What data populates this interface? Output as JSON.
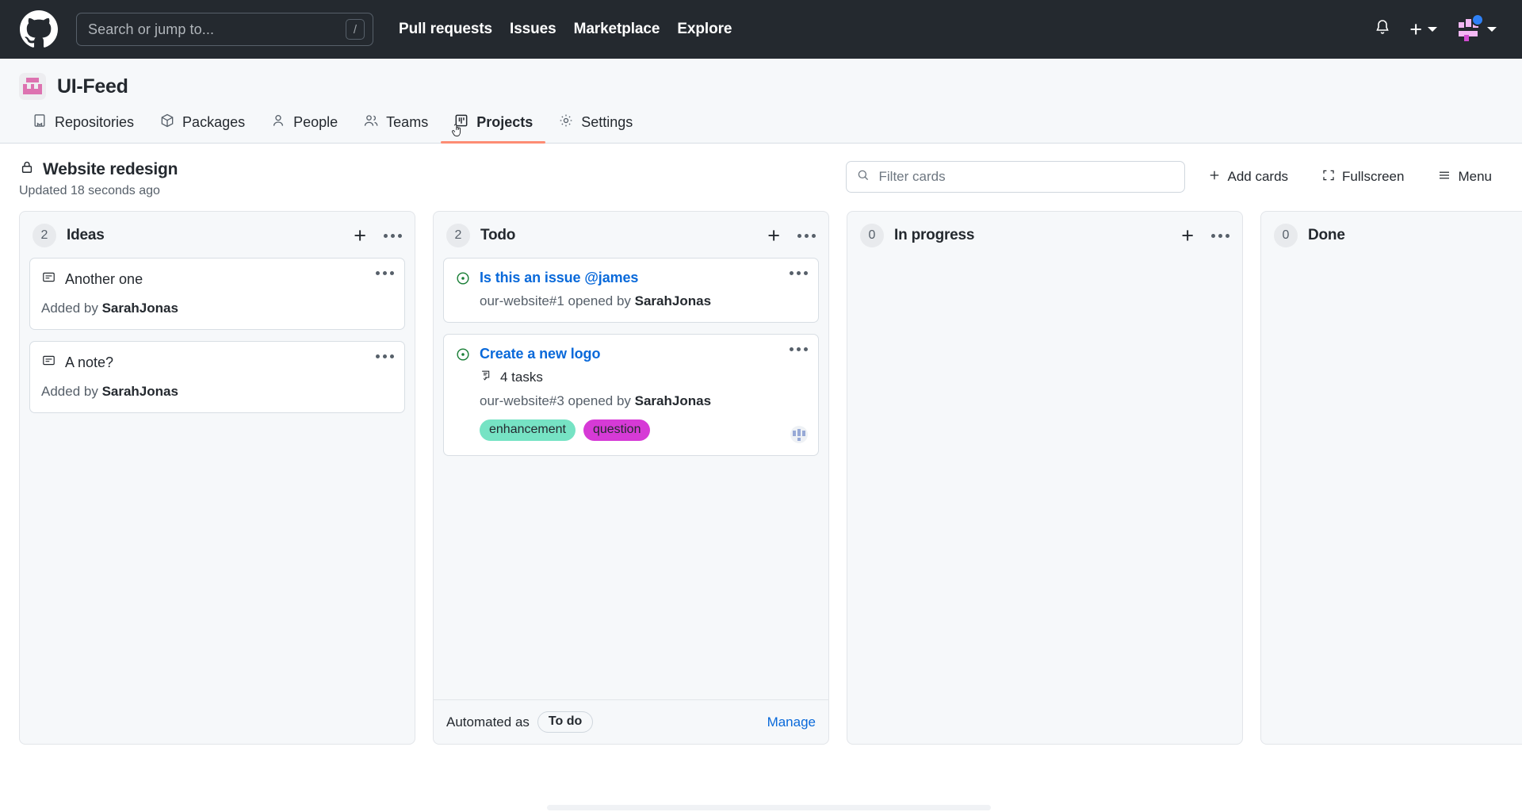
{
  "header": {
    "logo_icon": "github-mark-icon",
    "search": {
      "placeholder": "Search or jump to...",
      "shortcut_key": "/",
      "icon": "search-icon"
    },
    "nav": [
      {
        "label": "Pull requests"
      },
      {
        "label": "Issues"
      },
      {
        "label": "Marketplace"
      },
      {
        "label": "Explore"
      }
    ],
    "notifications_icon": "bell-icon",
    "create_new_label": "+",
    "create_new_icon": "plus-icon",
    "account_icon": "avatar",
    "caret_icon": "chevron-down-icon",
    "bg_color": "#24292f"
  },
  "org": {
    "name": "UI-Feed",
    "avatar_icon": "org-avatar-identicon",
    "tabs": [
      {
        "label": "Repositories",
        "icon": "repo-icon",
        "active": false
      },
      {
        "label": "Packages",
        "icon": "package-icon",
        "active": false
      },
      {
        "label": "People",
        "icon": "person-icon",
        "active": false
      },
      {
        "label": "Teams",
        "icon": "people-icon",
        "active": false
      },
      {
        "label": "Projects",
        "icon": "project-board-icon",
        "active": true
      },
      {
        "label": "Settings",
        "icon": "gear-icon",
        "active": false
      }
    ],
    "active_tab_underline_color": "#fd8c73"
  },
  "project": {
    "title": "Website redesign",
    "visibility_icon": "lock-icon",
    "updated": "Updated 18 seconds ago",
    "filter": {
      "placeholder": "Filter cards",
      "value": "",
      "icon": "search-icon"
    },
    "add_cards_label": "Add cards",
    "add_cards_icon": "plus-icon",
    "fullscreen_label": "Fullscreen",
    "fullscreen_icon": "fullscreen-icon",
    "menu_label": "Menu",
    "menu_icon": "hamburger-icon"
  },
  "board": {
    "columns": [
      {
        "name": "Ideas",
        "count": "2",
        "add_icon": "plus-icon",
        "more_icon": "kebab-icon",
        "footer": null,
        "cards": [
          {
            "type": "note",
            "icon": "note-icon",
            "title": "Another one",
            "meta_prefix": "Added by ",
            "meta_author": "SarahJonas",
            "more_icon": "kebab-icon"
          },
          {
            "type": "note",
            "icon": "note-icon",
            "title": "A note?",
            "meta_prefix": "Added by ",
            "meta_author": "SarahJonas",
            "more_icon": "kebab-icon"
          }
        ]
      },
      {
        "name": "Todo",
        "count": "2",
        "add_icon": "plus-icon",
        "more_icon": "kebab-icon",
        "footer": {
          "automated_label": "Automated as",
          "automated_value": "To do",
          "manage_label": "Manage"
        },
        "cards": [
          {
            "type": "issue",
            "icon": "issue-opened-icon",
            "icon_color": "#1a7f37",
            "title": "Is this an issue @james",
            "meta_prefix": "our-website#1 opened by ",
            "meta_author": "SarahJonas",
            "more_icon": "kebab-icon",
            "tasks": null,
            "labels": [],
            "avatar": false
          },
          {
            "type": "issue",
            "icon": "issue-opened-icon",
            "icon_color": "#1a7f37",
            "title": "Create a new logo",
            "meta_prefix": "our-website#3 opened by ",
            "meta_author": "SarahJonas",
            "more_icon": "kebab-icon",
            "tasks": "4 tasks",
            "tasks_icon": "tasklist-icon",
            "labels": [
              {
                "text": "enhancement",
                "color": "#76e3c4"
              },
              {
                "text": "question",
                "color": "#d63ad6"
              }
            ],
            "avatar": true
          }
        ]
      },
      {
        "name": "In progress",
        "count": "0",
        "add_icon": "plus-icon",
        "more_icon": "kebab-icon",
        "footer": null,
        "cards": []
      },
      {
        "name": "Done",
        "count": "0",
        "add_icon": "plus-icon",
        "more_icon": "kebab-icon",
        "footer": null,
        "cards": []
      }
    ]
  }
}
